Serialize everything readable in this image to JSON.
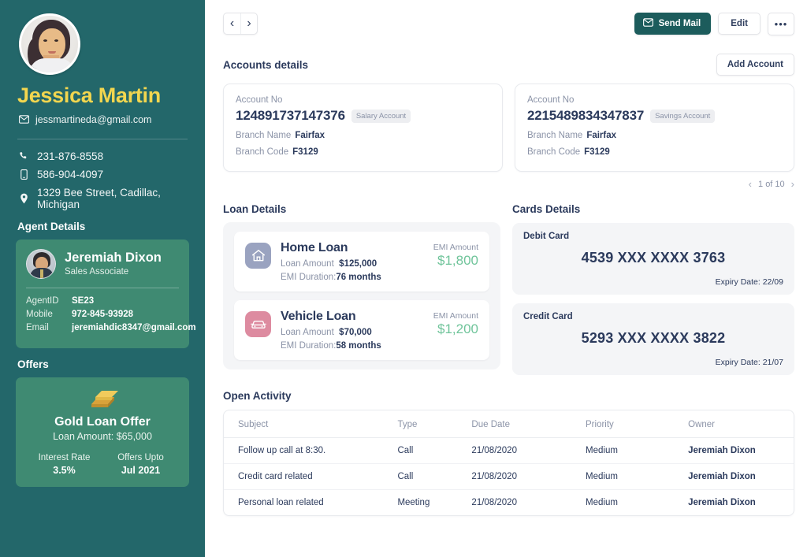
{
  "sidebar": {
    "profile": {
      "name": "Jessica Martin",
      "email": "jessmartineda@gmail.com",
      "phone": "231-876-8558",
      "mobile": "586-904-4097",
      "address": "1329  Bee Street, Cadillac, Michigan"
    },
    "agent_section_label": "Agent Details",
    "agent": {
      "name": "Jeremiah Dixon",
      "role": "Sales Associate",
      "fields": [
        {
          "key": "AgentID",
          "value": "SE23"
        },
        {
          "key": "Mobile",
          "value": "972-845-93928"
        },
        {
          "key": "Email",
          "value": "jeremiahdic8347@gmail.com"
        }
      ]
    },
    "offers_section_label": "Offers",
    "offer": {
      "icon": "gold-bars-icon",
      "title": "Gold Loan Offer",
      "subtitle": "Loan Amount: $65,000",
      "interest_rate_label": "Interest Rate",
      "interest_rate_value": "3.5%",
      "offers_upto_label": "Offers Upto",
      "offers_upto_value": "Jul 2021"
    }
  },
  "topbar": {
    "prev_label": "‹",
    "next_label": "›",
    "send_mail_label": "Send Mail",
    "edit_label": "Edit",
    "more_label": "•••"
  },
  "accounts": {
    "title": "Accounts details",
    "add_button_label": "Add Account",
    "account_no_label": "Account No",
    "branch_name_label": "Branch Name",
    "branch_code_label": "Branch Code",
    "cards": [
      {
        "number": "124891737147376",
        "badge": "Salary Account",
        "branch_name": "Fairfax",
        "branch_code": "F3129"
      },
      {
        "number": "2215489834347837",
        "badge": "Savings Account",
        "branch_name": "Fairfax",
        "branch_code": "F3129"
      }
    ],
    "pagination": "1 of 10"
  },
  "loans": {
    "title": "Loan Details",
    "emi_amount_label": "EMI Amount",
    "loan_amount_label": "Loan Amount",
    "emi_duration_label": "EMI Duration:",
    "items": [
      {
        "icon": "house-icon",
        "name": "Home Loan",
        "loan_amount": "$125,000",
        "emi_duration": "76 months",
        "emi_amount": "$1,800"
      },
      {
        "icon": "car-icon",
        "name": "Vehicle Loan",
        "loan_amount": "$70,000",
        "emi_duration": "58 months",
        "emi_amount": "$1,200"
      }
    ]
  },
  "cards_details": {
    "title": "Cards Details",
    "items": [
      {
        "type": "Debit Card",
        "number": "4539 XXX XXXX 3763",
        "expiry": "Expiry Date: 22/09"
      },
      {
        "type": "Credit Card",
        "number": "5293 XXX XXXX 3822",
        "expiry": "Expiry Date: 21/07"
      }
    ]
  },
  "open_activity": {
    "title": "Open Activity",
    "columns": [
      "Subject",
      "Type",
      "Due Date",
      "Priority",
      "Owner"
    ],
    "rows": [
      {
        "subject": "Follow up call at 8:30.",
        "type": "Call",
        "due_date": "21/08/2020",
        "priority": "Medium",
        "owner": "Jeremiah Dixon"
      },
      {
        "subject": "Credit card related",
        "type": "Call",
        "due_date": "21/08/2020",
        "priority": "Medium",
        "owner": "Jeremiah Dixon"
      },
      {
        "subject": "Personal loan related",
        "type": "Meeting",
        "due_date": "21/08/2020",
        "priority": "Medium",
        "owner": "Jeremiah Dixon"
      }
    ]
  },
  "colors": {
    "sidebar_bg": "#23676a",
    "card_green": "#3f8a72",
    "name_gold": "#f2d64f",
    "primary_btn": "#1c5c5c",
    "text_dark": "#2b3a5c",
    "text_muted": "#8b93a7",
    "emi_green": "#6fc49a"
  }
}
